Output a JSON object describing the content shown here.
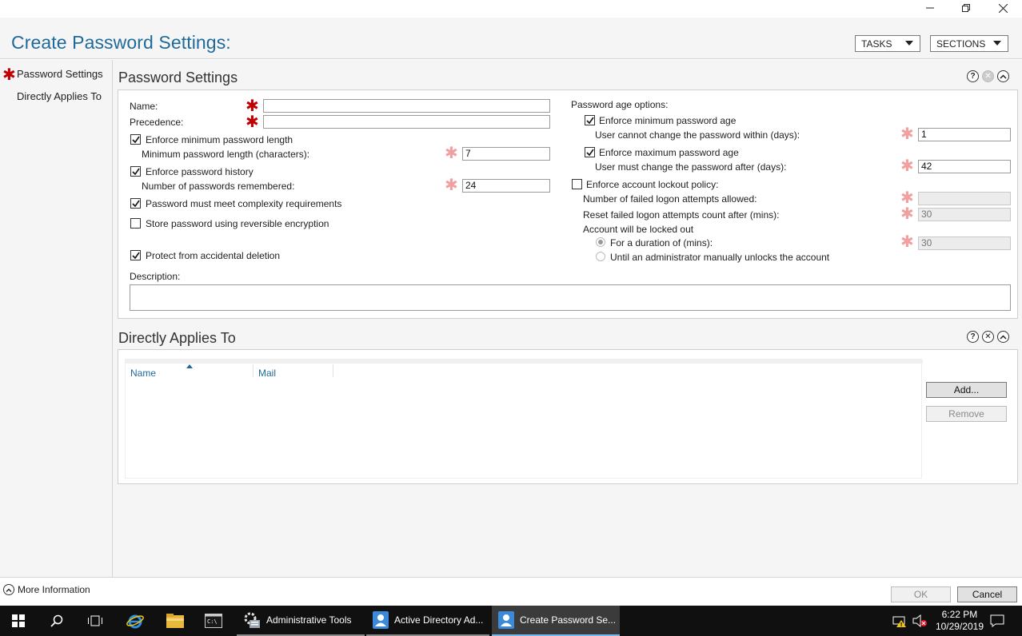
{
  "window": {
    "title": "Create Password Settings:",
    "tasks_label": "TASKS",
    "sections_label": "SECTIONS"
  },
  "nav": {
    "items": [
      {
        "label": "Password Settings",
        "required": true
      },
      {
        "label": "Directly Applies To",
        "required": false
      }
    ]
  },
  "password_settings": {
    "heading": "Password Settings",
    "name_label": "Name:",
    "name_value": "",
    "precedence_label": "Precedence:",
    "precedence_value": "",
    "enforce_min_length_label": "Enforce minimum password length",
    "enforce_min_length_checked": true,
    "min_length_label": "Minimum password length (characters):",
    "min_length_value": "7",
    "enforce_history_label": "Enforce password history",
    "enforce_history_checked": true,
    "history_count_label": "Number of passwords remembered:",
    "history_count_value": "24",
    "complexity_label": "Password must meet complexity requirements",
    "complexity_checked": true,
    "reversible_label": "Store password using reversible encryption",
    "reversible_checked": false,
    "protect_label": "Protect from accidental deletion",
    "protect_checked": true,
    "description_label": "Description:",
    "description_value": "",
    "age_options_label": "Password age options:",
    "enforce_min_age_label": "Enforce minimum password age",
    "enforce_min_age_checked": true,
    "min_age_label": "User cannot change the password within (days):",
    "min_age_value": "1",
    "enforce_max_age_label": "Enforce maximum password age",
    "enforce_max_age_checked": true,
    "max_age_label": "User must change the password after (days):",
    "max_age_value": "42",
    "lockout_policy_label": "Enforce account lockout policy:",
    "lockout_policy_checked": false,
    "failed_attempts_label": "Number of failed logon attempts allowed:",
    "failed_attempts_value": "",
    "reset_after_label": "Reset failed logon attempts count after (mins):",
    "reset_after_value": "30",
    "locked_out_label": "Account will be locked out",
    "duration_label": "For a duration of (mins):",
    "duration_value": "30",
    "duration_selected": true,
    "until_admin_label": "Until an administrator manually unlocks the account"
  },
  "applies_to": {
    "heading": "Directly Applies To",
    "columns": [
      "Name",
      "Mail"
    ],
    "rows": [],
    "add_label": "Add...",
    "remove_label": "Remove"
  },
  "footer": {
    "more_info_label": "More Information",
    "ok_label": "OK",
    "cancel_label": "Cancel"
  },
  "taskbar": {
    "apps": [
      {
        "label": "Administrative Tools",
        "icon": "admin-tools-icon",
        "state": "open"
      },
      {
        "label": "Active Directory Ad...",
        "icon": "active-directory-icon",
        "state": "open"
      },
      {
        "label": "Create Password Se...",
        "icon": "active-directory-icon",
        "state": "active"
      }
    ],
    "time": "6:22 PM",
    "date": "10/29/2019"
  }
}
